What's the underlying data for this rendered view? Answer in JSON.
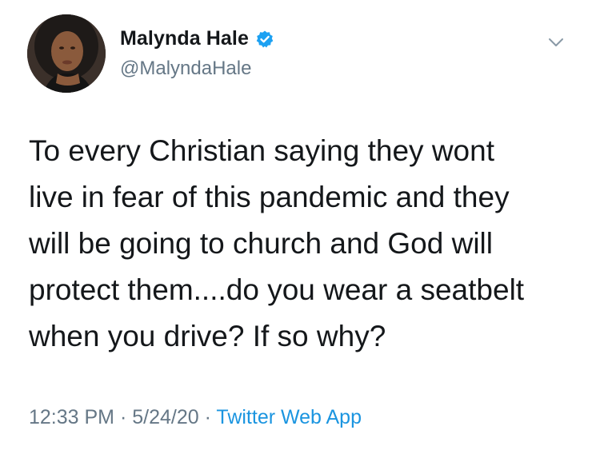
{
  "author": {
    "display_name": "Malynda Hale",
    "handle": "@MalyndaHale",
    "verified": true,
    "avatar_icon": "profile-photo"
  },
  "tweet": {
    "text": "To every Christian saying they wont\nlive in fear of this pandemic and they\nwill be going to church and God will\nprotect them....do you wear a seatbelt\nwhen you drive? If so why?"
  },
  "meta": {
    "time": "12:33 PM",
    "separator_1": " · ",
    "date": "5/24/20",
    "separator_2": " · ",
    "source": "Twitter Web App"
  },
  "colors": {
    "text": "#14171a",
    "secondary": "#657786",
    "link": "#1b95e0",
    "verified": "#1da1f2"
  },
  "icons": {
    "verified": "verified-badge-icon",
    "menu": "chevron-down-icon"
  }
}
